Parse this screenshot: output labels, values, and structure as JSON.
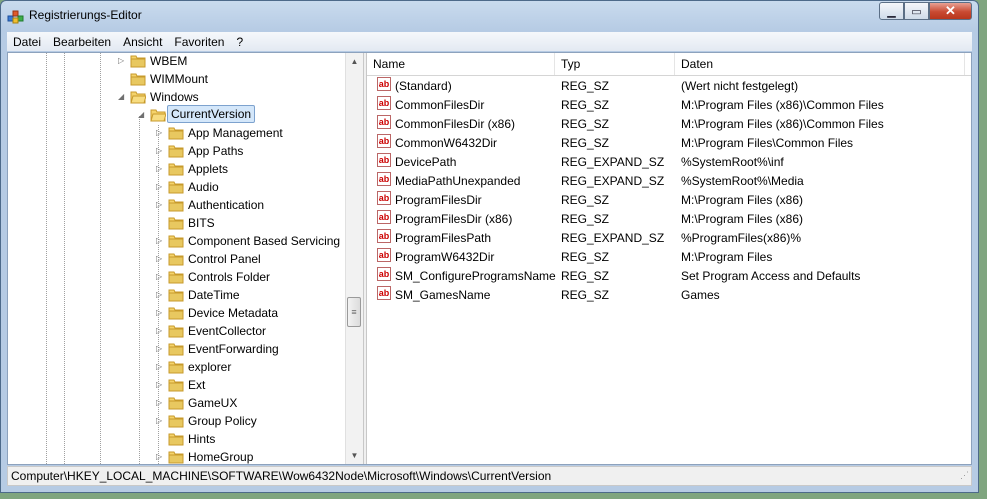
{
  "window": {
    "title": "Registrierungs-Editor"
  },
  "caption": {
    "minimize": "▁",
    "maximize": "▭",
    "close": "✕"
  },
  "menu": [
    "Datei",
    "Bearbeiten",
    "Ansicht",
    "Favoriten",
    "?"
  ],
  "tree": [
    {
      "label": "WBEM",
      "expander": "▷",
      "level": 0
    },
    {
      "label": "WIMMount",
      "expander": "",
      "level": 0
    },
    {
      "label": "Windows",
      "expander": "◢",
      "level": 0
    },
    {
      "label": "CurrentVersion",
      "expander": "◢",
      "level": 1,
      "selected": true
    },
    {
      "label": "App Management",
      "expander": "▷",
      "level": 2
    },
    {
      "label": "App Paths",
      "expander": "▷",
      "level": 2
    },
    {
      "label": "Applets",
      "expander": "▷",
      "level": 2
    },
    {
      "label": "Audio",
      "expander": "▷",
      "level": 2
    },
    {
      "label": "Authentication",
      "expander": "▷",
      "level": 2
    },
    {
      "label": "BITS",
      "expander": "",
      "level": 2
    },
    {
      "label": "Component Based Servicing",
      "expander": "▷",
      "level": 2
    },
    {
      "label": "Control Panel",
      "expander": "▷",
      "level": 2
    },
    {
      "label": "Controls Folder",
      "expander": "▷",
      "level": 2
    },
    {
      "label": "DateTime",
      "expander": "▷",
      "level": 2
    },
    {
      "label": "Device Metadata",
      "expander": "▷",
      "level": 2
    },
    {
      "label": "EventCollector",
      "expander": "▷",
      "level": 2
    },
    {
      "label": "EventForwarding",
      "expander": "▷",
      "level": 2
    },
    {
      "label": "explorer",
      "expander": "▷",
      "level": 2
    },
    {
      "label": "Ext",
      "expander": "▷",
      "level": 2
    },
    {
      "label": "GameUX",
      "expander": "▷",
      "level": 2
    },
    {
      "label": "Group Policy",
      "expander": "▷",
      "level": 2
    },
    {
      "label": "Hints",
      "expander": "",
      "level": 2
    },
    {
      "label": "HomeGroup",
      "expander": "▷",
      "level": 2
    }
  ],
  "list": {
    "columns": [
      "Name",
      "Typ",
      "Daten"
    ],
    "rows": [
      {
        "icon": "string-value-icon",
        "name": "(Standard)",
        "type": "REG_SZ",
        "data": "(Wert nicht festgelegt)"
      },
      {
        "icon": "string-value-icon",
        "name": "CommonFilesDir",
        "type": "REG_SZ",
        "data": "M:\\Program Files (x86)\\Common Files"
      },
      {
        "icon": "string-value-icon",
        "name": "CommonFilesDir (x86)",
        "type": "REG_SZ",
        "data": "M:\\Program Files (x86)\\Common Files"
      },
      {
        "icon": "string-value-icon",
        "name": "CommonW6432Dir",
        "type": "REG_SZ",
        "data": "M:\\Program Files\\Common Files"
      },
      {
        "icon": "string-value-icon",
        "name": "DevicePath",
        "type": "REG_EXPAND_SZ",
        "data": "%SystemRoot%\\inf"
      },
      {
        "icon": "string-value-icon",
        "name": "MediaPathUnexpanded",
        "type": "REG_EXPAND_SZ",
        "data": "%SystemRoot%\\Media"
      },
      {
        "icon": "string-value-icon",
        "name": "ProgramFilesDir",
        "type": "REG_SZ",
        "data": "M:\\Program Files (x86)"
      },
      {
        "icon": "string-value-icon",
        "name": "ProgramFilesDir (x86)",
        "type": "REG_SZ",
        "data": "M:\\Program Files (x86)"
      },
      {
        "icon": "string-value-icon",
        "name": "ProgramFilesPath",
        "type": "REG_EXPAND_SZ",
        "data": "%ProgramFiles(x86)%"
      },
      {
        "icon": "string-value-icon",
        "name": "ProgramW6432Dir",
        "type": "REG_SZ",
        "data": "M:\\Program Files"
      },
      {
        "icon": "string-value-icon",
        "name": "SM_ConfigureProgramsName",
        "type": "REG_SZ",
        "data": "Set Program Access and Defaults"
      },
      {
        "icon": "string-value-icon",
        "name": "SM_GamesName",
        "type": "REG_SZ",
        "data": "Games"
      }
    ]
  },
  "statusbar": {
    "path": "Computer\\HKEY_LOCAL_MACHINE\\SOFTWARE\\Wow6432Node\\Microsoft\\Windows\\CurrentVersion"
  },
  "colors": {
    "selection": "#d4e7fa",
    "folder": "#e8c860",
    "title_bg": "#b6cbe4"
  }
}
